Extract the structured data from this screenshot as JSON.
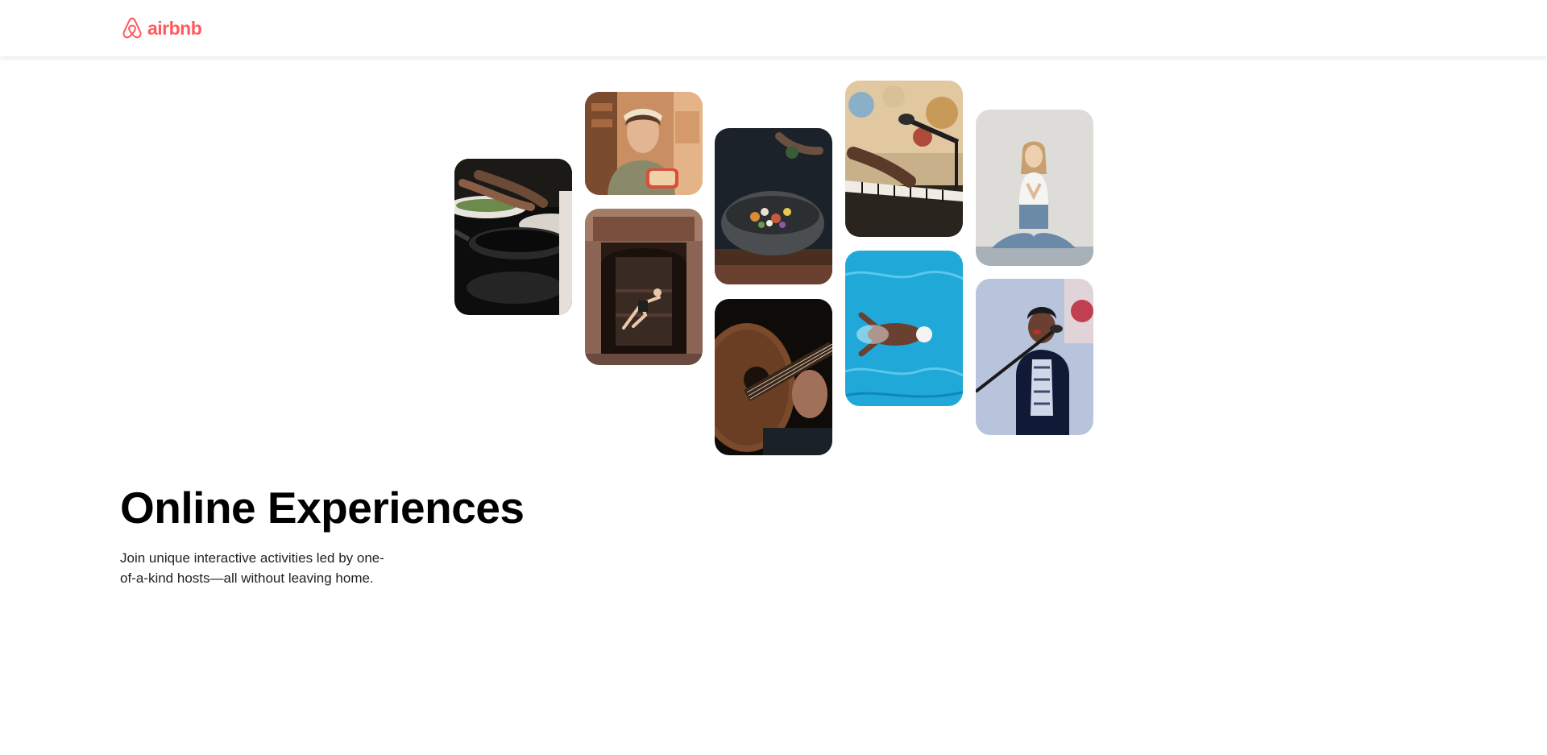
{
  "header": {
    "logo_text": "airbnb",
    "logo_icon": "airbnb-belo-icon",
    "brand_color": "#FF5A5F"
  },
  "gallery": {
    "photos": [
      {
        "subject": "cooking-pans"
      },
      {
        "subject": "baker-with-bread"
      },
      {
        "subject": "dancer-in-doorway"
      },
      {
        "subject": "food-bowl"
      },
      {
        "subject": "acoustic-guitar"
      },
      {
        "subject": "keyboard-microphone"
      },
      {
        "subject": "swimmer-in-pool"
      },
      {
        "subject": "yoga-meditation"
      },
      {
        "subject": "singer-with-microphone"
      }
    ]
  },
  "hero": {
    "title": "Online Experiences",
    "description": "Join unique interactive activities led by one-of-a-kind hosts—all without leaving home."
  }
}
